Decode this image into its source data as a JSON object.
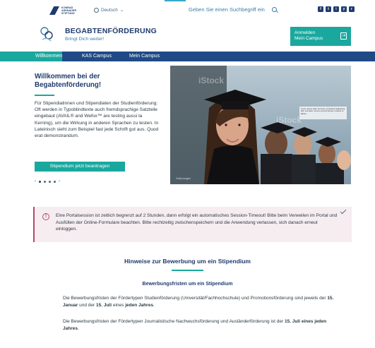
{
  "topbar": {
    "logo_line1": "KONRAD",
    "logo_line2": "ADENAUER",
    "logo_line3": "STIFTUNG",
    "language": "Deutsch",
    "search_placeholder": "Geben Sie einen Suchbegriff ein",
    "social": [
      "f",
      "t",
      "i",
      "y",
      "r"
    ]
  },
  "header": {
    "title": "BEGABTENFÖRDERUNG",
    "subtitle": "Bringt Dich weiter!",
    "login_line1": "Anmelden",
    "login_line2": "Mein Campus",
    "login_arrow": "⇥"
  },
  "nav": {
    "items": [
      "Willkommen",
      "KAS Campus",
      "Mein Campus"
    ]
  },
  "welcome": {
    "title": "Willkommen bei der Begabtenförderung!",
    "text": "Für Stipendiatinnen und Stipendiaten der Studienförderung: Oft werden in Typoblindtexte auch fremdsprachige Satzteile eingebaut (AVAIL® and Wefox™ are testing aussi la Kerning), um die Wirkung in anderen Sprachen zu testen. In Lateinisch sieht zum Beispiel fast jede Schrift gut aus. Quod erat demonstrandum.",
    "cta": "Stipendium jetzt beantragen",
    "prev": "‹",
    "next": "›"
  },
  "hero": {
    "caption": "Lorem ipsum dolor sit amet, consetetur sadipscing elitr, sed diam nonumy eirmod tempor invidunt ut labore.",
    "watermark": "iStock",
    "credit": "Getty Images"
  },
  "notice": {
    "icon": "!",
    "text": "Eine Portalsession ist zeitlich begrenzt auf 2 Stunden, dann erfolgt ein automatisches Session-Timeout! Bitte beim Verweilen im Portal und Ausfüllen der Online-Formulare beachten. Bitte rechtzeitig zwischenspeichern und die Anwendung verlassen, sich danach erneut einloggen."
  },
  "hints": {
    "title": "Hinweise zur Bewerbung um ein Stipendium",
    "subtitle": "Bewerbungsfristen um ein Stipendium",
    "p1_a": "Die Bewerbungsfristen der Fördertypen Studienförderung (Universität/Fachhochschule) und Promotionsförderung sind jeweils der ",
    "p1_b": "15. Januar",
    "p1_c": " und der ",
    "p1_d": "15. Juli",
    "p1_e": " eines ",
    "p1_f": "jeden Jahres",
    "p1_g": ".",
    "p2_a": "Die Bewerbungsfristen der Fördertypen Journalistische Nachwuchsförderung und Ausländerförderung ist der ",
    "p2_b": "15. Juli eines jeden Jahres",
    "p2_c": "."
  },
  "colors": {
    "teal": "#1aa89e",
    "navy": "#1f4a86",
    "brand": "#1f3b6e",
    "alert": "#b8486a"
  }
}
